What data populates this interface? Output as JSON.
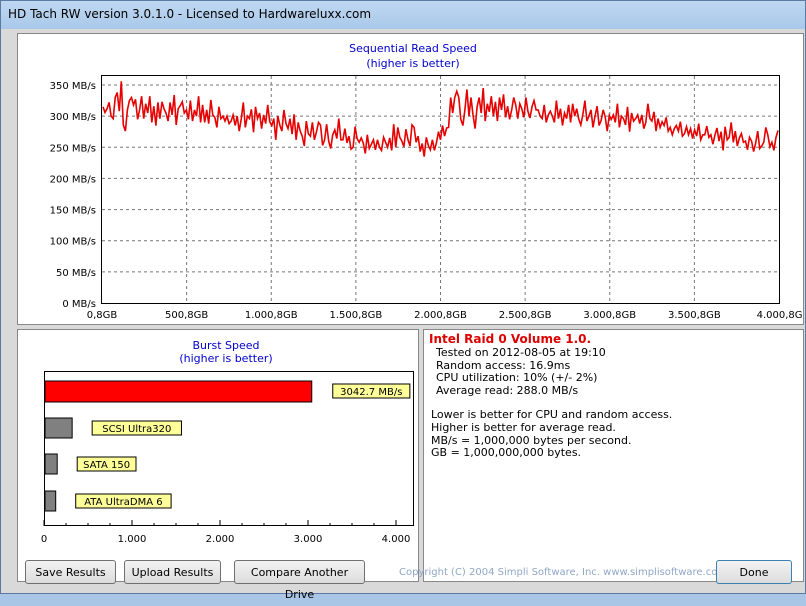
{
  "window": {
    "title": "HD Tach RW version 3.0.1.0 - Licensed to Hardwareluxx.com"
  },
  "seq_chart": {
    "title": "Sequential Read Speed",
    "subtitle": "(higher is better)"
  },
  "burst_chart": {
    "title": "Burst Speed",
    "subtitle": "(higher is better)"
  },
  "chart_data": [
    {
      "type": "line",
      "title": "Sequential Read Speed",
      "subtitle": "(higher is better)",
      "x_unit": "GB",
      "xlim": [
        0.8,
        4000.8
      ],
      "ylim": [
        0,
        350
      ],
      "x_tick_labels": [
        "0,8GB",
        "500,8GB",
        "1.000,8GB",
        "1.500,8GB",
        "2.000,8GB",
        "2.500,8GB",
        "3.000,8GB",
        "3.500,8GB",
        "4.000,8GB"
      ],
      "y_tick_labels": [
        "0 MB/s",
        "50 MB/s",
        "100 MB/s",
        "150 MB/s",
        "200 MB/s",
        "250 MB/s",
        "300 MB/s",
        "350 MB/s"
      ],
      "grid": true,
      "series_color": "#e60000",
      "y_values": [
        315,
        306,
        312,
        322,
        300,
        296,
        330,
        338,
        308,
        356,
        286,
        276,
        310,
        325,
        330,
        318,
        327,
        295,
        310,
        332,
        296,
        320,
        305,
        332,
        290,
        316,
        285,
        322,
        296,
        323,
        312,
        305,
        292,
        322,
        302,
        334,
        286,
        312,
        317,
        323,
        305,
        310,
        295,
        325,
        292,
        310,
        300,
        332,
        290,
        318,
        290,
        310,
        288,
        326,
        302,
        298,
        282,
        315,
        296,
        300,
        292,
        300,
        288,
        292,
        302,
        285,
        300,
        276,
        296,
        322,
        282,
        300,
        296,
        311,
        274,
        315,
        296,
        305,
        280,
        302,
        288,
        318,
        291,
        285,
        296,
        262,
        300,
        285,
        276,
        310,
        288,
        280,
        296,
        271,
        303,
        262,
        290,
        276,
        268,
        252,
        292,
        272,
        268,
        290,
        262,
        275,
        290,
        286,
        253,
        262,
        287,
        260,
        248,
        270,
        278,
        264,
        296,
        262,
        262,
        280,
        257,
        268,
        247,
        250,
        283,
        264,
        258,
        265,
        257,
        240,
        270,
        248,
        255,
        262,
        246,
        262,
        250,
        245,
        266,
        258,
        250,
        265,
        245,
        287,
        250,
        282,
        266,
        260,
        251,
        279,
        262,
        252,
        286,
        282,
        258,
        268,
        243,
        256,
        235,
        266,
        253,
        246,
        262,
        245,
        257,
        275,
        262,
        285,
        268,
        281,
        282,
        330,
        305,
        330,
        340,
        330,
        295,
        285,
        310,
        343,
        300,
        330,
        302,
        280,
        315,
        330,
        305,
        345,
        292,
        320,
        307,
        332,
        300,
        323,
        292,
        330,
        310,
        335,
        298,
        316,
        295,
        310,
        330,
        318,
        296,
        320,
        312,
        298,
        330,
        308,
        297,
        315,
        325,
        310,
        310,
        300,
        296,
        318,
        290,
        302,
        308,
        300,
        290,
        325,
        296,
        312,
        285,
        305,
        296,
        318,
        290,
        320,
        300,
        312,
        295,
        286,
        302,
        325,
        292,
        300,
        310,
        282,
        300,
        316,
        285,
        293,
        310,
        299,
        276,
        301,
        295,
        302,
        290,
        320,
        282,
        300,
        296,
        286,
        315,
        275,
        305,
        292,
        296,
        302,
        288,
        302,
        280,
        290,
        320,
        296,
        292,
        307,
        276,
        296,
        282,
        291,
        285,
        298,
        276,
        282,
        270,
        280,
        285,
        276,
        291,
        268,
        272,
        283,
        270,
        280,
        264,
        278,
        268,
        288,
        262,
        270,
        270,
        284,
        266,
        270,
        255,
        270,
        281,
        260,
        275,
        245,
        283,
        262,
        266,
        290,
        258,
        276,
        252,
        265,
        272,
        258,
        260,
        246,
        266,
        260,
        243,
        256,
        276,
        248,
        252,
        258,
        282,
        270,
        251,
        258,
        245,
        266,
        277
      ]
    },
    {
      "type": "bar",
      "orientation": "horizontal",
      "title": "Burst Speed",
      "subtitle": "(higher is better)",
      "categories": [
        "3042.7 MB/s",
        "SCSI Ultra320",
        "SATA 150",
        "ATA UltraDMA 6"
      ],
      "values": [
        3042.7,
        320,
        150,
        133
      ],
      "bar_colors": [
        "#ff0000",
        "#808080",
        "#808080",
        "#808080"
      ],
      "xlim": [
        0,
        4000
      ],
      "x_tick_labels": [
        "0",
        "1.000",
        "2.000",
        "3.000",
        "4.000"
      ],
      "x_ticks": [
        0,
        1000,
        2000,
        3000,
        4000
      ],
      "minor_ticks": [
        250,
        500,
        750,
        1250,
        1500,
        1750,
        2250,
        2500,
        2750,
        3250,
        3500,
        3750
      ]
    }
  ],
  "info": {
    "drive_name": "Intel Raid 0 Volume 1.0.",
    "tested_on": "Tested on 2012-08-05 at 19:10",
    "random_access": "Random access: 16.9ms",
    "cpu_utilization": "CPU utilization: 10% (+/- 2%)",
    "average_read": "Average read: 288.0 MB/s",
    "note1": "Lower is better for CPU and random access.",
    "note2": "Higher is better for average read.",
    "note3": "MB/s = 1,000,000 bytes per second.",
    "note4": "GB = 1,000,000,000 bytes."
  },
  "buttons": {
    "save": "Save Results",
    "upload": "Upload Results",
    "compare": "Compare Another Drive",
    "done": "Done"
  },
  "copyright": "Copyright (C) 2004 Simpli Software, Inc. www.simplisoftware.com"
}
